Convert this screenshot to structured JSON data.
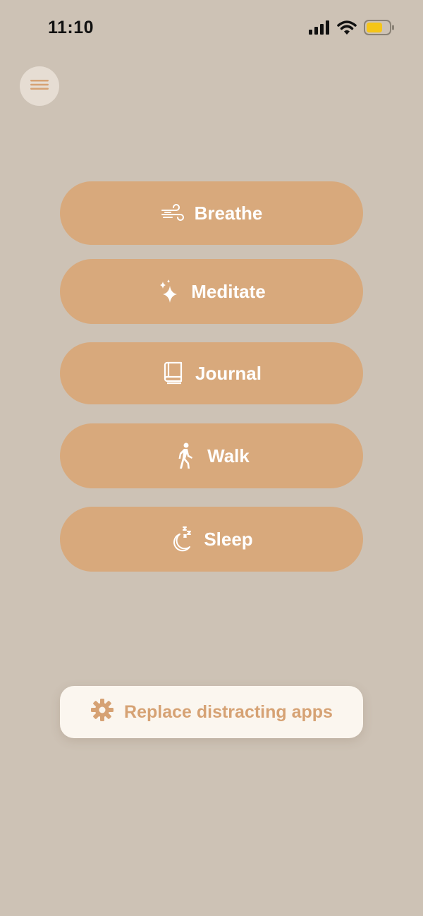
{
  "status_bar": {
    "time": "11:10",
    "icons": [
      "cellular-signal-icon",
      "wifi-icon",
      "battery-icon"
    ],
    "battery_color": "#f5c518"
  },
  "menu": {
    "icon": "hamburger-menu-icon"
  },
  "activities": [
    {
      "label": "Breathe",
      "icon": "wind-icon"
    },
    {
      "label": "Meditate",
      "icon": "sparkles-icon"
    },
    {
      "label": "Journal",
      "icon": "book-icon"
    },
    {
      "label": "Walk",
      "icon": "walking-person-icon"
    },
    {
      "label": "Sleep",
      "icon": "moon-zzz-icon"
    }
  ],
  "replace_apps": {
    "label": "Replace distracting apps",
    "icon": "gear-icon"
  },
  "colors": {
    "background": "#cdc2b5",
    "activity_button": "#d8a97c",
    "activity_text": "#ffffff",
    "replace_button_bg": "#fbf6ef",
    "replace_button_text": "#d6a274",
    "menu_button_bg": "#e6ddd3"
  }
}
